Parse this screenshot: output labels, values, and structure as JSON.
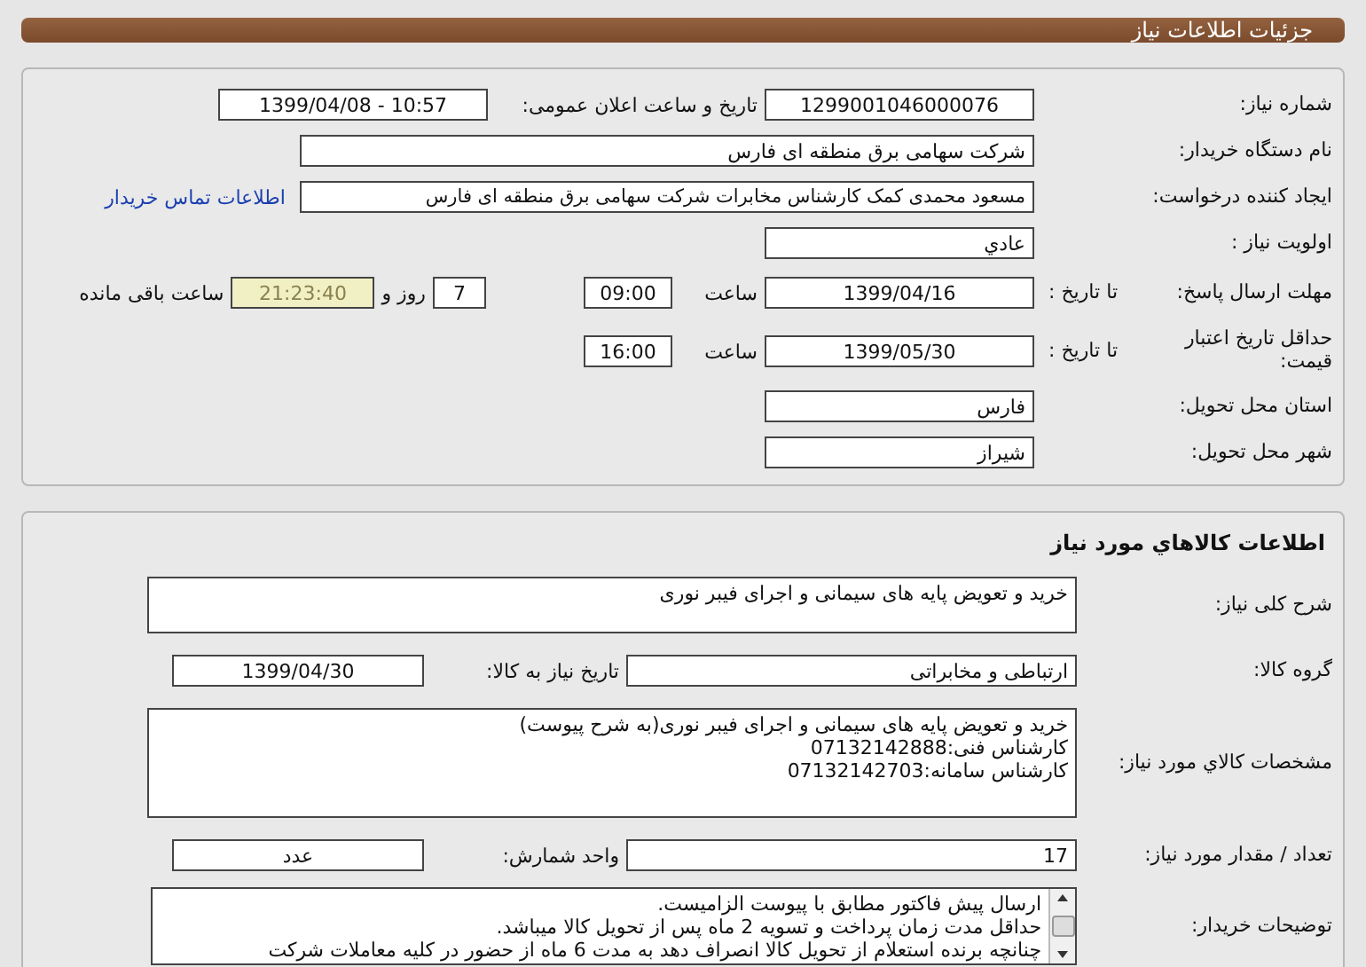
{
  "header": {
    "title": "جزئیات اطلاعات نیاز"
  },
  "need_info": {
    "rows": [
      {
        "kind": "pair",
        "label": "شماره نیاز:",
        "value": "1299001046000076",
        "label_2": "تاریخ و ساعت اعلان عمومی:",
        "value_2": "1399/04/08 - 10:57"
      },
      {
        "kind": "wide",
        "label": "نام دستگاه خریدار:",
        "value": "شرکت سهامی برق منطقه ای فارس"
      },
      {
        "kind": "link",
        "label": "ایجاد کننده درخواست:",
        "value": "مسعود محمدی کمک کارشناس مخابرات شرکت سهامی برق منطقه ای فارس",
        "link": "اطلاعات تماس خریدار"
      },
      {
        "kind": "single",
        "label": "اولویت نیاز :",
        "value": "عادي"
      },
      {
        "kind": "deadline",
        "label": "مهلت ارسال پاسخ:",
        "sublabel": "تا تاریخ :",
        "value": "1399/04/16",
        "time_label": "ساعت",
        "time": "09:00",
        "days": "7",
        "days_label": "روز و",
        "remaining": "21:23:40",
        "remaining_label": "ساعت باقی مانده"
      },
      {
        "kind": "validity",
        "label": "حداقل تاریخ اعتبار قیمت:",
        "sublabel": "تا تاریخ :",
        "value": "1399/05/30",
        "time_label": "ساعت",
        "time": "16:00"
      },
      {
        "kind": "single",
        "label": "استان محل تحویل:",
        "value": "فارس"
      },
      {
        "kind": "single",
        "label": "شهر محل تحویل:",
        "value": "شیراز"
      }
    ]
  },
  "goods_info": {
    "title": "اطلاعات کالاهاي مورد نیاز",
    "rows": [
      {
        "kind": "textarea",
        "label": "شرح کلی نیاز:",
        "lines": [
          "خرید و تعویض پایه های سیمانی و اجرای فیبر نوری"
        ]
      },
      {
        "kind": "pair",
        "label": "گروه کالا:",
        "value": "ارتباطی و مخابراتی",
        "label_2": "تاریخ نیاز به کالا:",
        "value_2": "1399/04/30"
      },
      {
        "kind": "textarea",
        "label": "مشخصات کالاي مورد نیاز:",
        "lines": [
          "خرید و تعویض پایه های سیمانی و اجرای فیبر نوری(به شرح پیوست)",
          "کارشناس فنی:07132142888",
          "کارشناس سامانه:07132142703"
        ]
      },
      {
        "kind": "pair",
        "label": "تعداد / مقدار مورد نیاز:",
        "value": "17",
        "label_2": "واحد شمارش:",
        "value_2": "عدد"
      },
      {
        "kind": "scroll",
        "label": "توضیحات خریدار:",
        "lines": [
          "ارسال پیش فاکتور مطابق با پیوست الزامیست.",
          "حداقل مدت زمان پرداخت و تسویه 2 ماه پس از تحویل کالا میباشد.",
          "چنانچه برنده استعلام از تحویل کالا انصراف دهد به مدت 6 ماه از حضور در کلیه معاملات شرکت"
        ]
      }
    ]
  }
}
